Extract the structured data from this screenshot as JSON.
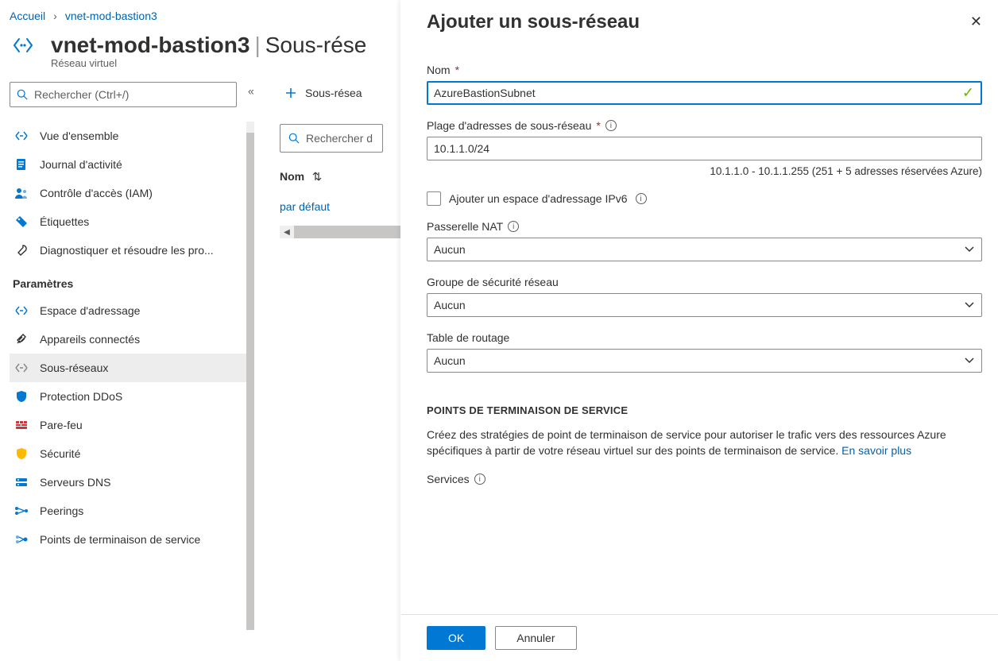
{
  "breadcrumb": {
    "home": "Accueil",
    "current": "vnet-mod-bastion3"
  },
  "page": {
    "title": "vnet-mod-bastion3",
    "section": "Sous-rése",
    "subtitle": "Réseau virtuel",
    "search_placeholder": "Rechercher (Ctrl+/)"
  },
  "nav": {
    "items": [
      {
        "label": "Vue d'ensemble"
      },
      {
        "label": "Journal d'activité"
      },
      {
        "label": "Contrôle d'accès (IAM)"
      },
      {
        "label": "Étiquettes"
      },
      {
        "label": "Diagnostiquer et résoudre les pro..."
      }
    ],
    "section_label": "Paramètres",
    "settings": [
      {
        "label": "Espace d'adressage"
      },
      {
        "label": "Appareils connectés"
      },
      {
        "label": "Sous-réseaux",
        "selected": true
      },
      {
        "label": "Protection DDoS"
      },
      {
        "label": "Pare-feu"
      },
      {
        "label": "Sécurité"
      },
      {
        "label": "Serveurs DNS"
      },
      {
        "label": "Peerings"
      },
      {
        "label": "Points de terminaison de service"
      }
    ]
  },
  "content": {
    "add_button": "Sous-résea",
    "search_placeholder": "Rechercher d",
    "col_name": "Nom",
    "row1": "par défaut"
  },
  "blade": {
    "title": "Ajouter un sous-réseau",
    "name_label": "Nom",
    "name_value": "AzureBastionSubnet",
    "range_label": "Plage d'adresses de sous-réseau",
    "range_value": "10.1.1.0/24",
    "range_hint": "10.1.1.0 - 10.1.1.255 (251 + 5 adresses réservées Azure)",
    "ipv6_label": "Ajouter un espace d'adressage IPv6",
    "nat_label": "Passerelle NAT",
    "nat_value": "Aucun",
    "nsg_label": "Groupe de sécurité réseau",
    "nsg_value": "Aucun",
    "rt_label": "Table de routage",
    "rt_value": "Aucun",
    "sep_heading": "POINTS DE TERMINAISON DE SERVICE",
    "sep_text": "Créez des stratégies de point de terminaison de service pour autoriser le trafic vers des ressources Azure spécifiques à partir de votre réseau virtuel sur des points de terminaison de service. ",
    "sep_link": "En savoir plus",
    "services_label": "Services",
    "ok": "OK",
    "cancel": "Annuler"
  }
}
